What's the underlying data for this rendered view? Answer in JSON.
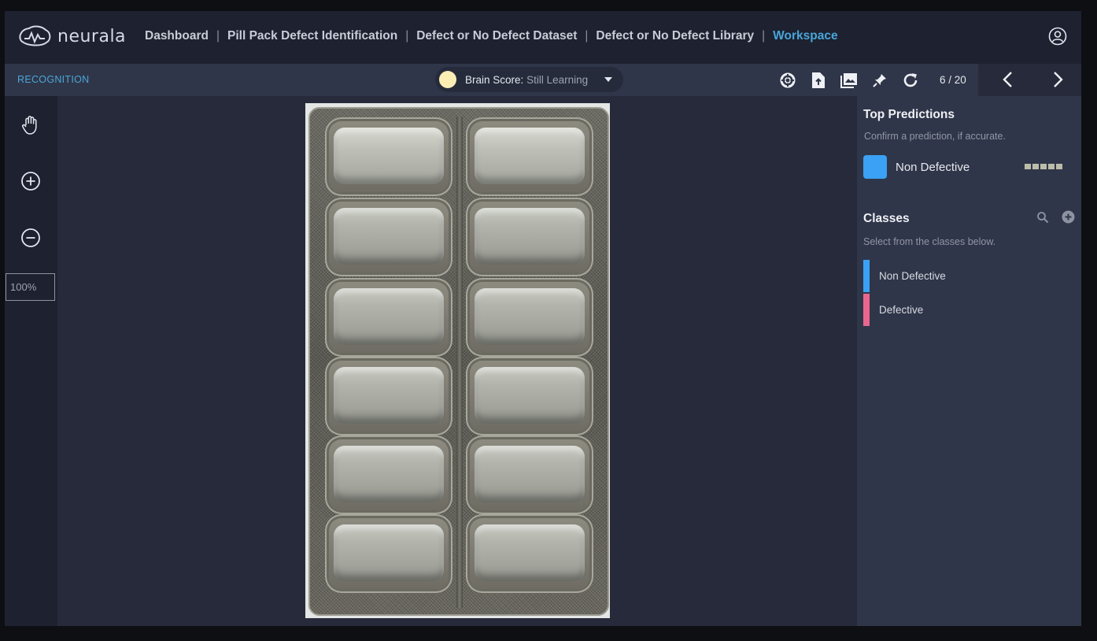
{
  "app": {
    "brand": "neurala"
  },
  "breadcrumb": [
    {
      "label": "Dashboard",
      "active": false
    },
    {
      "label": "Pill Pack Defect Identification",
      "active": false
    },
    {
      "label": "Defect or No Defect Dataset",
      "active": false
    },
    {
      "label": "Defect or No Defect Library",
      "active": false
    },
    {
      "label": "Workspace",
      "active": true
    }
  ],
  "breadcrumb_separator": "|",
  "toolbar": {
    "mode": "RECOGNITION",
    "brain_score_label": "Brain Score:",
    "brain_score_value": "Still Learning",
    "counter": "6 / 20",
    "tools": [
      "help-lifebuoy-icon",
      "upload-file-icon",
      "image-gallery-icon",
      "pin-icon",
      "refresh-icon"
    ]
  },
  "left_tools": {
    "tools": [
      "hand-pan-icon",
      "zoom-in-icon",
      "zoom-out-icon"
    ],
    "zoom_value": "100%"
  },
  "top_predictions": {
    "title": "Top Predictions",
    "subtitle": "Confirm a prediction, if accurate.",
    "items": [
      {
        "label": "Non Defective",
        "color": "#3aa1f5",
        "confidence_bars_filled": 5
      }
    ]
  },
  "classes": {
    "title": "Classes",
    "subtitle": "Select from the classes below.",
    "items": [
      {
        "label": "Non Defective",
        "color": "#3aa1f5"
      },
      {
        "label": "Defective",
        "color": "#e9668f"
      }
    ]
  },
  "colors": {
    "accent": "#4aa6d8",
    "brain_indicator": "#fbeeb5"
  }
}
